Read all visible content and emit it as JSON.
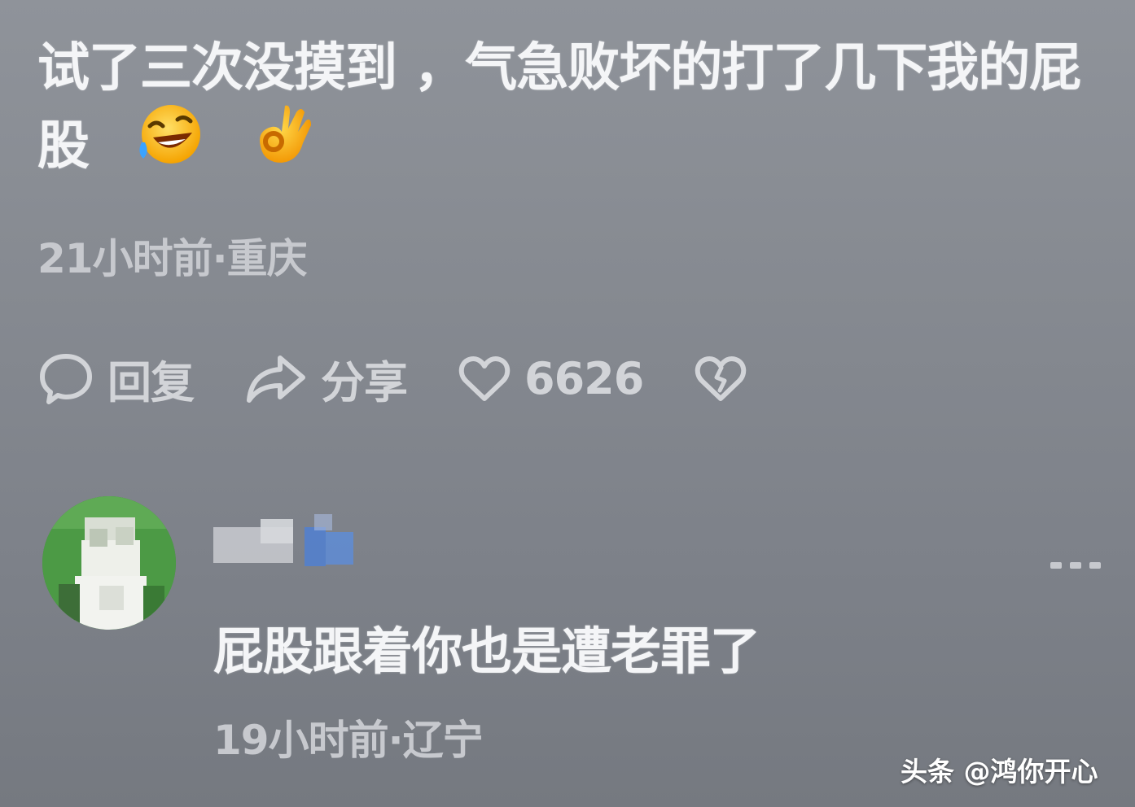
{
  "comment": {
    "text": "试了三次没摸到 ，气急败坏的打了几下我的屁股",
    "emojis": [
      "rofl-emoji",
      "ok-hand-emoji"
    ],
    "time_location": "21小时前·重庆"
  },
  "actions": {
    "reply_label": "回复",
    "share_label": "分享",
    "like_count": "6626",
    "icons": [
      "comment-bubble-icon",
      "share-arrow-icon",
      "heart-icon",
      "broken-heart-icon"
    ]
  },
  "reply": {
    "text": "屁股跟着你也是遭老罪了",
    "time_location": "19小时前·辽宁"
  },
  "watermark": {
    "text": "头条 @鸿你开心"
  },
  "colors": {
    "background": "#868a91",
    "primary_text": "#f4f5f7",
    "secondary_text": "#c7c9ce",
    "avatar_green": "#3f8a3a",
    "emoji_yellow": "#ffc423"
  }
}
